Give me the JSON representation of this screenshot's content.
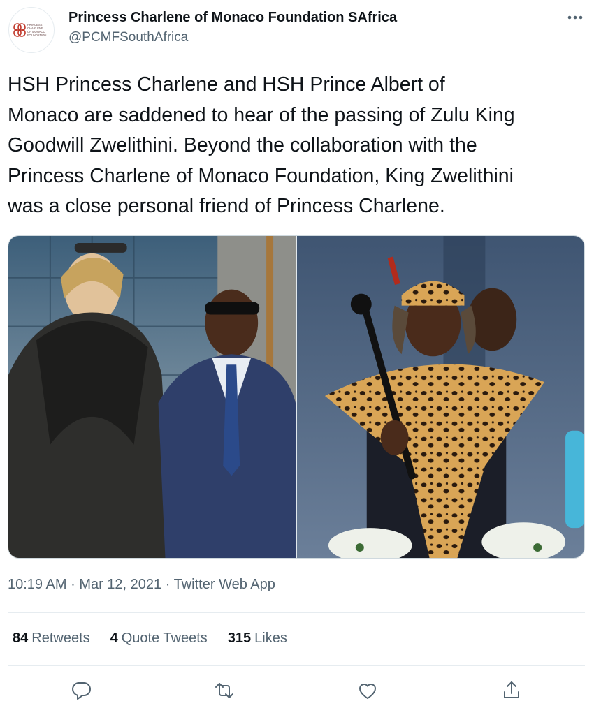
{
  "account": {
    "display_name": "Princess Charlene of Monaco Foundation SAfrica",
    "handle": "@PCMFSouthAfrica",
    "avatar_text": [
      "PRINCESS",
      "CHARLENE",
      "OF MONACO",
      "FOUNDATION"
    ]
  },
  "tweet": {
    "text_lines": [
      "HSH Princess Charlene and HSH Prince Albert of",
      "Monaco are saddened to hear of the passing of Zulu King",
      "Goodwill Zwelithini. Beyond the collaboration with the",
      "Princess Charlene of Monaco Foundation, King Zwelithini",
      "was a close personal friend of Princess Charlene."
    ],
    "time": "10:19 AM",
    "date": "Mar 12, 2021",
    "source": "Twitter Web App",
    "separator": "·"
  },
  "stats": {
    "retweets_count": "84",
    "retweets_label": "Retweets",
    "quotes_count": "4",
    "quotes_label": "Quote Tweets",
    "likes_count": "315",
    "likes_label": "Likes"
  },
  "icons": {
    "more": "more-horizontal-icon",
    "reply": "reply-icon",
    "retweet": "retweet-icon",
    "like": "heart-icon",
    "share": "share-icon"
  },
  "colors": {
    "text": "#0f1419",
    "secondary": "#536471",
    "divider": "#e6ecf0",
    "logo_red": "#c0392b"
  }
}
